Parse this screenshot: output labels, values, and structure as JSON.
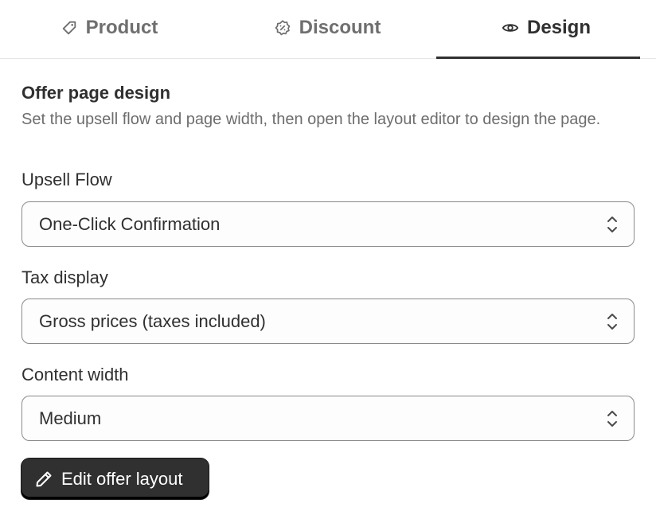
{
  "tabs": [
    {
      "label": "Product",
      "icon": "tag-icon",
      "active": false
    },
    {
      "label": "Discount",
      "icon": "discount-badge-icon",
      "active": false
    },
    {
      "label": "Design",
      "icon": "eye-icon",
      "active": true
    }
  ],
  "section": {
    "title": "Offer page design",
    "description": "Set the upsell flow and page width, then open the layout editor to design the page."
  },
  "fields": {
    "upsell_flow": {
      "label": "Upsell Flow",
      "value": "One-Click Confirmation"
    },
    "tax_display": {
      "label": "Tax display",
      "value": "Gross prices (taxes included)"
    },
    "content_width": {
      "label": "Content width",
      "value": "Medium"
    }
  },
  "edit_button": {
    "label": "Edit offer layout",
    "icon": "pencil-icon"
  },
  "colors": {
    "text": "#303030",
    "muted": "#6d6d6d",
    "button_bg": "#303030",
    "border": "#8a8a8a"
  }
}
